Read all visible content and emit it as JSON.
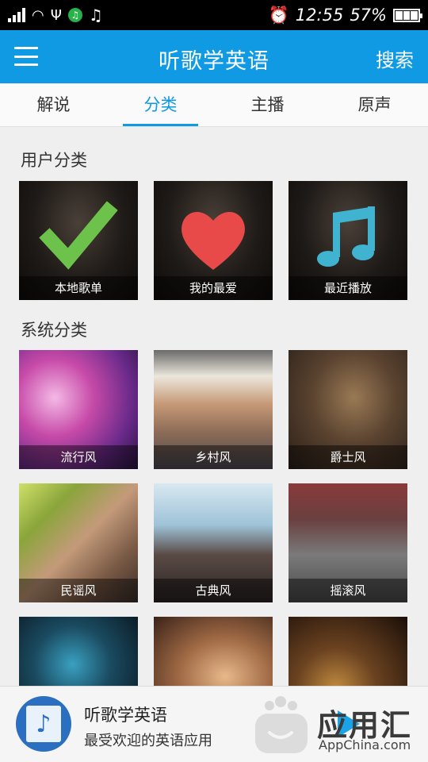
{
  "status_bar": {
    "time": "12:55",
    "battery": "57%"
  },
  "app_bar": {
    "title": "听歌学英语",
    "search_label": "搜索"
  },
  "tabs": [
    {
      "label": "解说",
      "active": false
    },
    {
      "label": "分类",
      "active": true
    },
    {
      "label": "主播",
      "active": false
    },
    {
      "label": "原声",
      "active": false
    }
  ],
  "user_section": {
    "title": "用户分类",
    "items": [
      {
        "label": "本地歌单",
        "icon": "checkmark-icon"
      },
      {
        "label": "我的最爱",
        "icon": "heart-icon"
      },
      {
        "label": "最近播放",
        "icon": "music-note-icon"
      }
    ]
  },
  "system_section": {
    "title": "系统分类",
    "items": [
      {
        "label": "流行风"
      },
      {
        "label": "乡村风"
      },
      {
        "label": "爵士风"
      },
      {
        "label": "民谣风"
      },
      {
        "label": "古典风"
      },
      {
        "label": "摇滚风"
      },
      {
        "label": ""
      },
      {
        "label": ""
      },
      {
        "label": ""
      }
    ]
  },
  "banner": {
    "title": "听歌学英语",
    "subtitle": "最受欢迎的英语应用",
    "watermark_brand": "应用汇",
    "watermark_site": "AppChina.com"
  },
  "colors": {
    "accent": "#0f9ae3",
    "check_green": "#6cc24a",
    "heart_red": "#e84a4a",
    "note_teal": "#3fb3d0"
  }
}
